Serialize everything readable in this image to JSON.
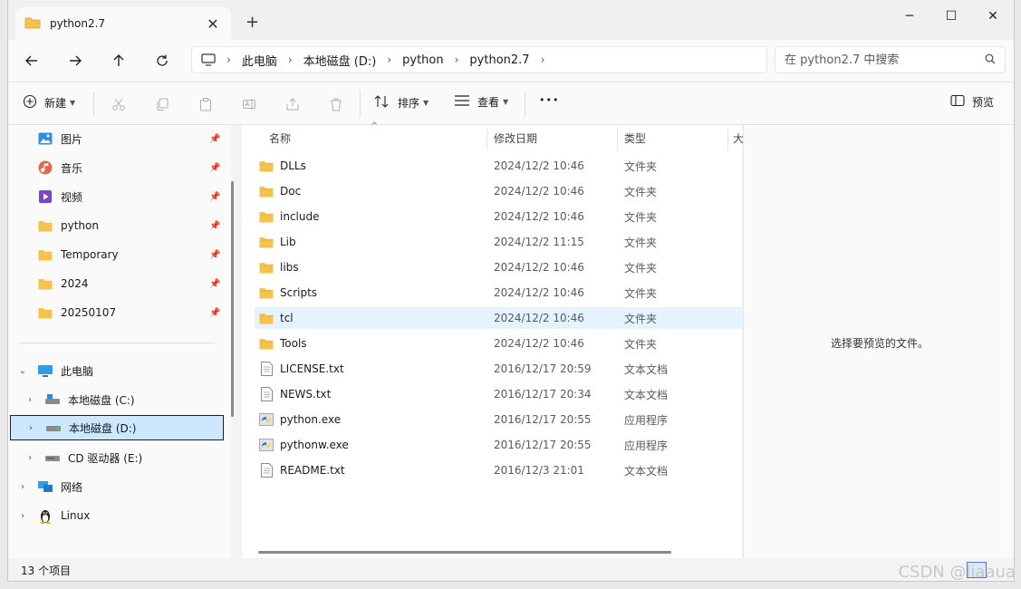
{
  "tab": {
    "title": "python2.7",
    "close": "✕",
    "new_tab": "+"
  },
  "window_controls": {
    "minimize": "─",
    "maximize": "☐",
    "close": "✕"
  },
  "address": {
    "breadcrumbs": [
      "此电脑",
      "本地磁盘 (D:)",
      "python",
      "python2.7"
    ]
  },
  "search": {
    "placeholder": "在 python2.7 中搜索"
  },
  "toolbar": {
    "new_label": "新建",
    "sort_label": "排序",
    "view_label": "查看",
    "more_label": "•••",
    "preview_label": "预览"
  },
  "sidebar": {
    "pinned": [
      {
        "label": "图片",
        "icon": "pictures-icon"
      },
      {
        "label": "音乐",
        "icon": "music-icon"
      },
      {
        "label": "视频",
        "icon": "video-icon"
      },
      {
        "label": "python",
        "icon": "folder-icon"
      },
      {
        "label": "Temporary",
        "icon": "folder-icon"
      },
      {
        "label": "2024",
        "icon": "folder-icon"
      },
      {
        "label": "20250107",
        "icon": "folder-icon"
      }
    ],
    "this_pc": "此电脑",
    "drives": [
      {
        "label": "本地磁盘 (C:)"
      },
      {
        "label": "本地磁盘 (D:)"
      },
      {
        "label": "CD 驱动器 (E:)"
      }
    ],
    "network": "网络",
    "linux": "Linux"
  },
  "columns": {
    "name": "名称",
    "date": "修改日期",
    "type": "类型",
    "size": "大"
  },
  "files": [
    {
      "name": "DLLs",
      "date": "2024/12/2 10:46",
      "type": "文件夹",
      "kind": "folder"
    },
    {
      "name": "Doc",
      "date": "2024/12/2 10:46",
      "type": "文件夹",
      "kind": "folder"
    },
    {
      "name": "include",
      "date": "2024/12/2 10:46",
      "type": "文件夹",
      "kind": "folder"
    },
    {
      "name": "Lib",
      "date": "2024/12/2 11:15",
      "type": "文件夹",
      "kind": "folder"
    },
    {
      "name": "libs",
      "date": "2024/12/2 10:46",
      "type": "文件夹",
      "kind": "folder"
    },
    {
      "name": "Scripts",
      "date": "2024/12/2 10:46",
      "type": "文件夹",
      "kind": "folder"
    },
    {
      "name": "tcl",
      "date": "2024/12/2 10:46",
      "type": "文件夹",
      "kind": "folder"
    },
    {
      "name": "Tools",
      "date": "2024/12/2 10:46",
      "type": "文件夹",
      "kind": "folder"
    },
    {
      "name": "LICENSE.txt",
      "date": "2016/12/17 20:59",
      "type": "文本文档",
      "kind": "text"
    },
    {
      "name": "NEWS.txt",
      "date": "2016/12/17 20:34",
      "type": "文本文档",
      "kind": "text"
    },
    {
      "name": "python.exe",
      "date": "2016/12/17 20:55",
      "type": "应用程序",
      "kind": "exe"
    },
    {
      "name": "pythonw.exe",
      "date": "2016/12/17 20:55",
      "type": "应用程序",
      "kind": "exe"
    },
    {
      "name": "README.txt",
      "date": "2016/12/3 21:01",
      "type": "文本文档",
      "kind": "text"
    }
  ],
  "preview": {
    "message": "选择要预览的文件。"
  },
  "status": {
    "count": "13 个项目"
  },
  "watermark": "CSDN @liaaua",
  "colors": {
    "folder": "#f5c24c",
    "selection": "#cce8ff",
    "hover": "#e5f3ff",
    "accent": "#0067c0"
  }
}
